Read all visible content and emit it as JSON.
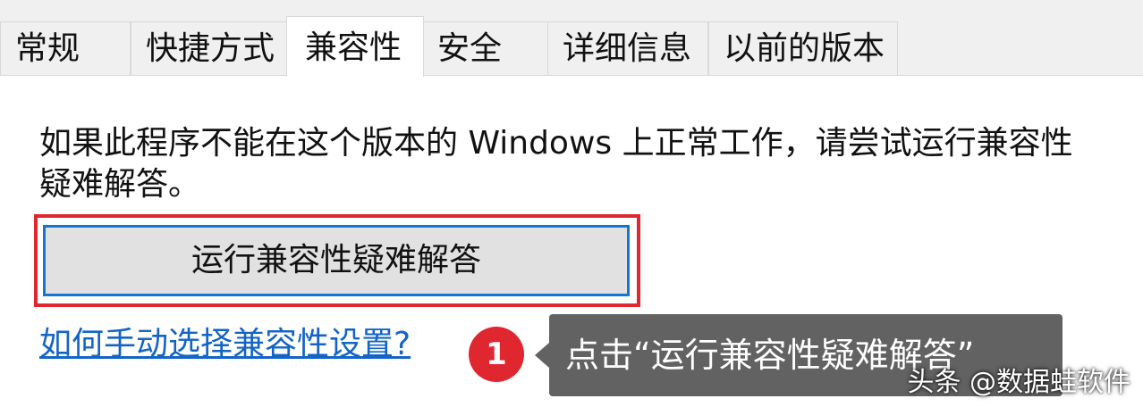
{
  "tabs": [
    {
      "label": "常规",
      "active": false
    },
    {
      "label": "快捷方式",
      "active": false
    },
    {
      "label": "兼容性",
      "active": true
    },
    {
      "label": "安全",
      "active": false
    },
    {
      "label": "详细信息",
      "active": false
    },
    {
      "label": "以前的版本",
      "active": false
    }
  ],
  "compatibility": {
    "description": "如果此程序不能在这个版本的 Windows 上正常工作，请尝试运行兼容性疑难解答。",
    "troubleshooter_button": "运行兼容性疑难解答",
    "manual_link": "如何手动选择兼容性设置?"
  },
  "annotation": {
    "step": "1",
    "callout_text": "点击“运行兼容性疑难解答”",
    "highlight_color": "#e0262e"
  },
  "watermark": "头条 @数据蛙软件",
  "colors": {
    "link": "#1464c8",
    "button_focus_border": "#1476d2",
    "callout_background": "#626262",
    "panel_background": "#ffffff",
    "window_background": "#f0f0f0"
  }
}
